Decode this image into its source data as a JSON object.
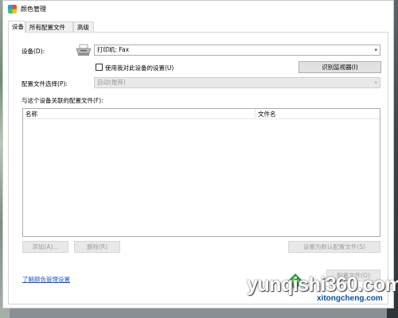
{
  "window": {
    "title": "颜色管理",
    "tabs": [
      {
        "label": "设备",
        "active": true
      },
      {
        "label": "所有配置文件",
        "active": false
      },
      {
        "label": "高级",
        "active": false
      }
    ]
  },
  "device": {
    "label": "设备(D):",
    "selected": "打印机: Fax",
    "use_my_settings_label": "使用我对此设备的设置(U)",
    "use_my_settings_checked": false,
    "identify_monitors_label": "识别监视器(I)"
  },
  "profile_selection": {
    "label": "配置文件选择(P):",
    "selected": "自动(推荐)"
  },
  "associated_profiles": {
    "label": "与这个设备关联的配置文件(F):",
    "columns": [
      "名称",
      "文件名"
    ],
    "rows": []
  },
  "buttons": {
    "add": "添加(A)...",
    "remove": "删除(R)",
    "set_default": "设置为默认配置文件(S)",
    "profiles": "配置文件(O)"
  },
  "link": {
    "label": "了解颜色管理设置"
  },
  "watermark": {
    "main": "yunqishi360.com",
    "sub": "xitongcheng.com"
  }
}
